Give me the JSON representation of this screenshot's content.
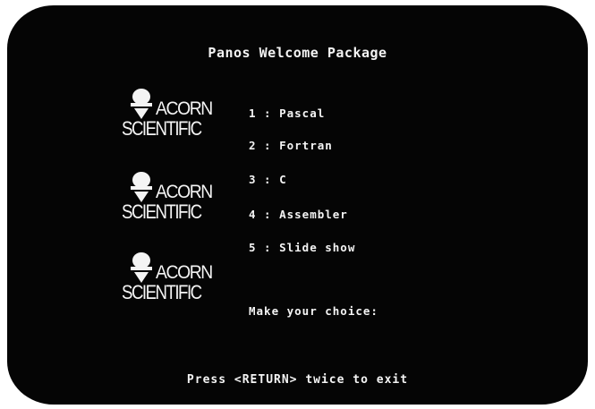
{
  "screen": {
    "title": "Panos Welcome Package",
    "menu": [
      {
        "label": "1 : Pascal"
      },
      {
        "label": "2 : Fortran"
      },
      {
        "label": "3 : C"
      },
      {
        "label": "4 : Assembler"
      },
      {
        "label": "5 : Slide show"
      }
    ],
    "prompt": "Make your choice:",
    "footer": "Press <RETURN> twice to exit"
  },
  "logos": [
    {
      "line1": "ACORN",
      "line2": "SCIENTIFIC",
      "icon": "acorn-icon"
    },
    {
      "line1": "ACORN",
      "line2": "SCIENTIFIC",
      "icon": "acorn-icon"
    },
    {
      "line1": "ACORN",
      "line2": "SCIENTIFIC",
      "icon": "acorn-icon"
    }
  ],
  "colors": {
    "screen_background": "#050505",
    "text": "#f4f4f4",
    "bezel": "#ffffff"
  }
}
